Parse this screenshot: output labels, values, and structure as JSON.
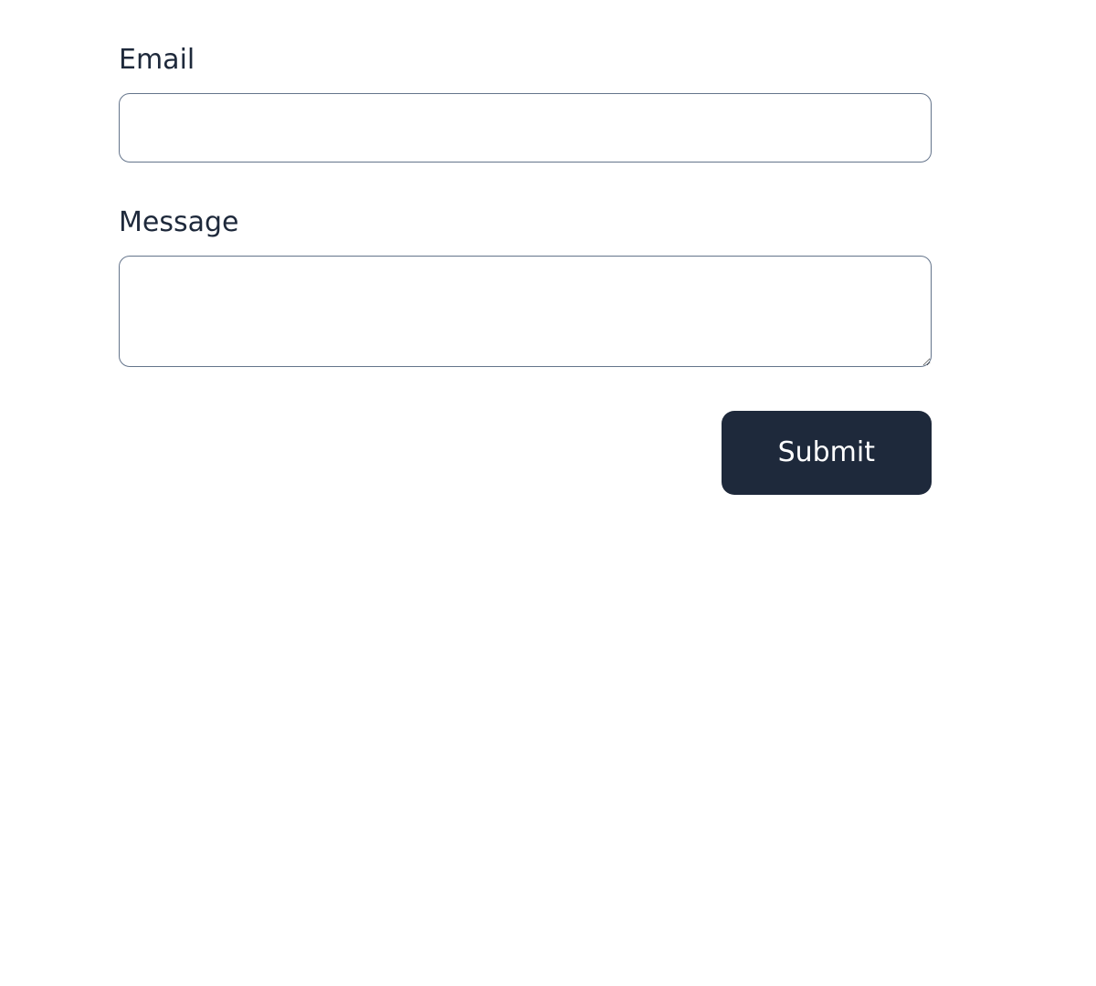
{
  "form": {
    "email": {
      "label": "Email",
      "value": ""
    },
    "message": {
      "label": "Message",
      "value": ""
    },
    "submit_label": "Submit"
  }
}
